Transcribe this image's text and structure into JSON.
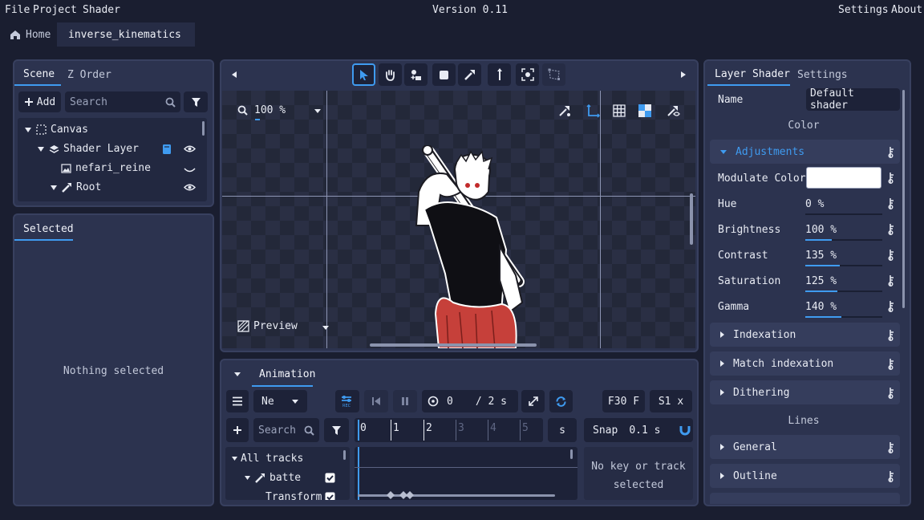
{
  "menu": {
    "file": "File",
    "project": "Project",
    "shader": "Shader",
    "version": "Version 0.11",
    "settings": "Settings",
    "about": "About"
  },
  "tabs": {
    "home": "Home",
    "document": "inverse_kinematics"
  },
  "scene": {
    "tab_scene": "Scene",
    "tab_zorder": "Z Order",
    "add_label": "Add",
    "search_placeholder": "Search",
    "tree": [
      {
        "label": "Canvas"
      },
      {
        "label": "Shader Layer"
      },
      {
        "label": "nefari_reine"
      },
      {
        "label": "Root"
      }
    ]
  },
  "selected": {
    "tab": "Selected",
    "empty": "Nothing selected"
  },
  "viewport": {
    "zoom": "100 %",
    "preview": "Preview"
  },
  "animation": {
    "tab": "Animation",
    "mode": "Ne",
    "time_current": "0",
    "time_total": "/ 2 s",
    "fps": "F30 F",
    "speed": "S1 x",
    "search_placeholder": "Search",
    "ruler": [
      "0",
      "1",
      "2",
      "3",
      "4",
      "5"
    ],
    "unit": "s",
    "snap_label": "Snap",
    "snap_value": "0.1 s",
    "tracks": [
      {
        "label": "All tracks"
      },
      {
        "label": "batte"
      },
      {
        "label": "Transform"
      }
    ],
    "no_key": "No key or track selected"
  },
  "layer_shader": {
    "tab_layer": "Layer Shader",
    "tab_settings": "Settings",
    "name_label": "Name",
    "name_value": "Default shader",
    "color_heading": "Color",
    "adjustments": "Adjustments",
    "modulate_label": "Modulate Color",
    "modulate_color": "#ffffff",
    "props": [
      {
        "label": "Hue",
        "value": "0 %",
        "fill": 0.0
      },
      {
        "label": "Brightness",
        "value": "100 %",
        "fill": 0.34
      },
      {
        "label": "Contrast",
        "value": "135 %",
        "fill": 0.45
      },
      {
        "label": "Saturation",
        "value": "125 %",
        "fill": 0.42
      },
      {
        "label": "Gamma",
        "value": "140 %",
        "fill": 0.47
      }
    ],
    "sections": [
      "Indexation",
      "Match indexation",
      "Dithering"
    ],
    "lines_heading": "Lines",
    "line_sections": [
      "General",
      "Outline"
    ]
  },
  "colors": {
    "accent": "#3f9bf0",
    "panel": "#2c334f",
    "background": "#1a1e30"
  }
}
